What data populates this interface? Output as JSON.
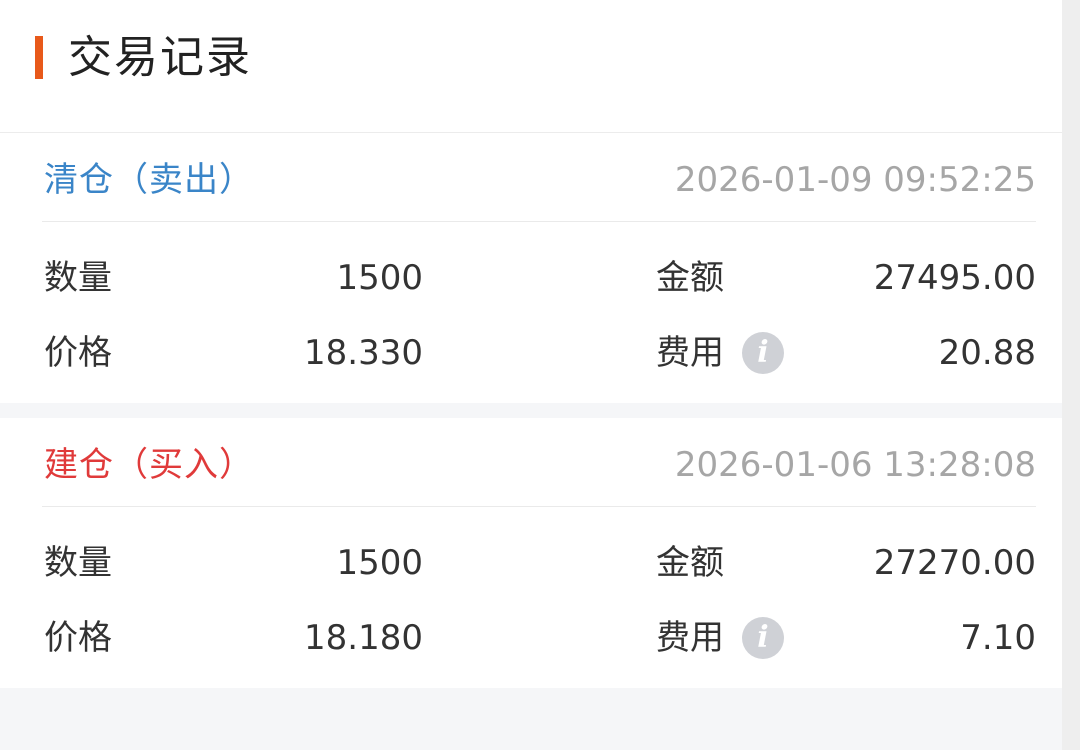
{
  "header": {
    "title": "交易记录"
  },
  "colors": {
    "accent": "#e8591a",
    "sell": "#3a85c8",
    "buy": "#e03a3a",
    "muted": "#a6a6a6"
  },
  "records": [
    {
      "type": "清仓（卖出）",
      "kind": "sell",
      "time": "2026-01-09 09:52:25",
      "quantity_label": "数量",
      "quantity": "1500",
      "amount_label": "金额",
      "amount": "27495.00",
      "price_label": "价格",
      "price": "18.330",
      "fee_label": "费用",
      "fee": "20.88",
      "fee_info_icon": "info-icon"
    },
    {
      "type": "建仓（买入）",
      "kind": "buy",
      "time": "2026-01-06 13:28:08",
      "quantity_label": "数量",
      "quantity": "1500",
      "amount_label": "金额",
      "amount": "27270.00",
      "price_label": "价格",
      "price": "18.180",
      "fee_label": "费用",
      "fee": "7.10",
      "fee_info_icon": "info-icon"
    }
  ]
}
